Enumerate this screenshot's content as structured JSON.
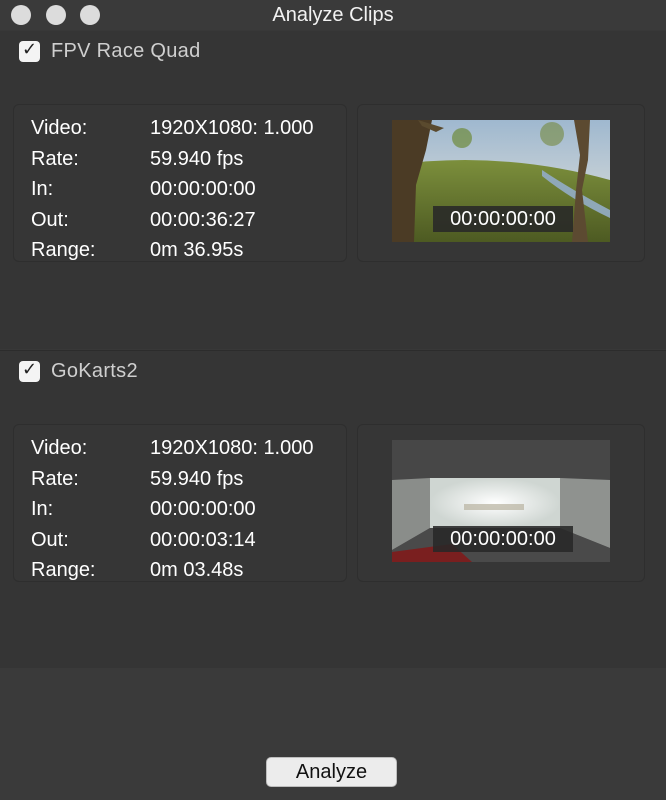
{
  "window": {
    "title": "Analyze Clips"
  },
  "clips": [
    {
      "name": "FPV Race Quad",
      "checked": true,
      "info": {
        "video_label": "Video:",
        "video_value": "1920X1080: 1.000",
        "rate_label": "Rate:",
        "rate_value": "59.940 fps",
        "in_label": "In:",
        "in_value": "00:00:00:00",
        "out_label": "Out:",
        "out_value": "00:00:36:27",
        "range_label": "Range:",
        "range_value": "0m 36.95s"
      },
      "thumbnail_timecode": "00:00:00:00"
    },
    {
      "name": "GoKarts2",
      "checked": true,
      "info": {
        "video_label": "Video:",
        "video_value": "1920X1080: 1.000",
        "rate_label": "Rate:",
        "rate_value": "59.940 fps",
        "in_label": "In:",
        "in_value": "00:00:00:00",
        "out_label": "Out:",
        "out_value": "00:00:03:14",
        "range_label": "Range:",
        "range_value": "0m 03.48s"
      },
      "thumbnail_timecode": "00:00:00:00"
    }
  ],
  "footer": {
    "analyze_label": "Analyze"
  },
  "icons": {
    "checkbox": "check-icon"
  },
  "colors": {
    "background": "#383838",
    "panel": "#363636",
    "text": "#ffffff",
    "button": "#ececec"
  }
}
